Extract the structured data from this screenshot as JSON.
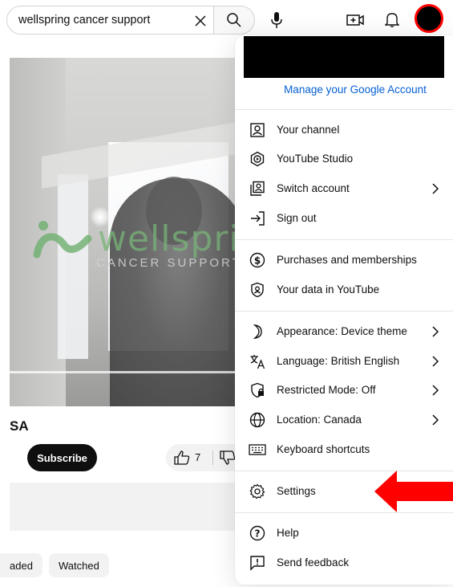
{
  "search": {
    "query": "wellspring cancer support"
  },
  "video": {
    "logo_word": "wellspring",
    "logo_sub": "CANCER SUPPORT"
  },
  "channel": {
    "name_fragment": "SA",
    "subscribe_label": "Subscribe",
    "like_count": "7"
  },
  "chips": [
    {
      "label": "aded"
    },
    {
      "label": "Watched"
    }
  ],
  "menu": {
    "manage_account": "Manage your Google Account",
    "items": [
      {
        "label": "Your channel",
        "icon": "person-box-icon"
      },
      {
        "label": "YouTube Studio",
        "icon": "studio-icon"
      },
      {
        "label": "Switch account",
        "icon": "switch-account-icon",
        "chevron": true
      },
      {
        "label": "Sign out",
        "icon": "sign-out-icon"
      },
      {
        "label": "Purchases and memberships",
        "icon": "dollar-circle-icon"
      },
      {
        "label": "Your data in YouTube",
        "icon": "shield-person-icon"
      },
      {
        "label": "Appearance: Device theme",
        "icon": "moon-icon",
        "chevron": true
      },
      {
        "label": "Language: British English",
        "icon": "translate-icon",
        "chevron": true
      },
      {
        "label": "Restricted Mode: Off",
        "icon": "restricted-shield-icon",
        "chevron": true
      },
      {
        "label": "Location: Canada",
        "icon": "globe-icon",
        "chevron": true
      },
      {
        "label": "Keyboard shortcuts",
        "icon": "keyboard-icon"
      },
      {
        "label": "Settings",
        "icon": "gear-icon"
      },
      {
        "label": "Help",
        "icon": "help-circle-icon"
      },
      {
        "label": "Send feedback",
        "icon": "feedback-icon"
      }
    ]
  },
  "colors": {
    "accent_link": "#065fd4",
    "avatar_ring": "#ff0000",
    "annotation_arrow": "#ff0000"
  }
}
